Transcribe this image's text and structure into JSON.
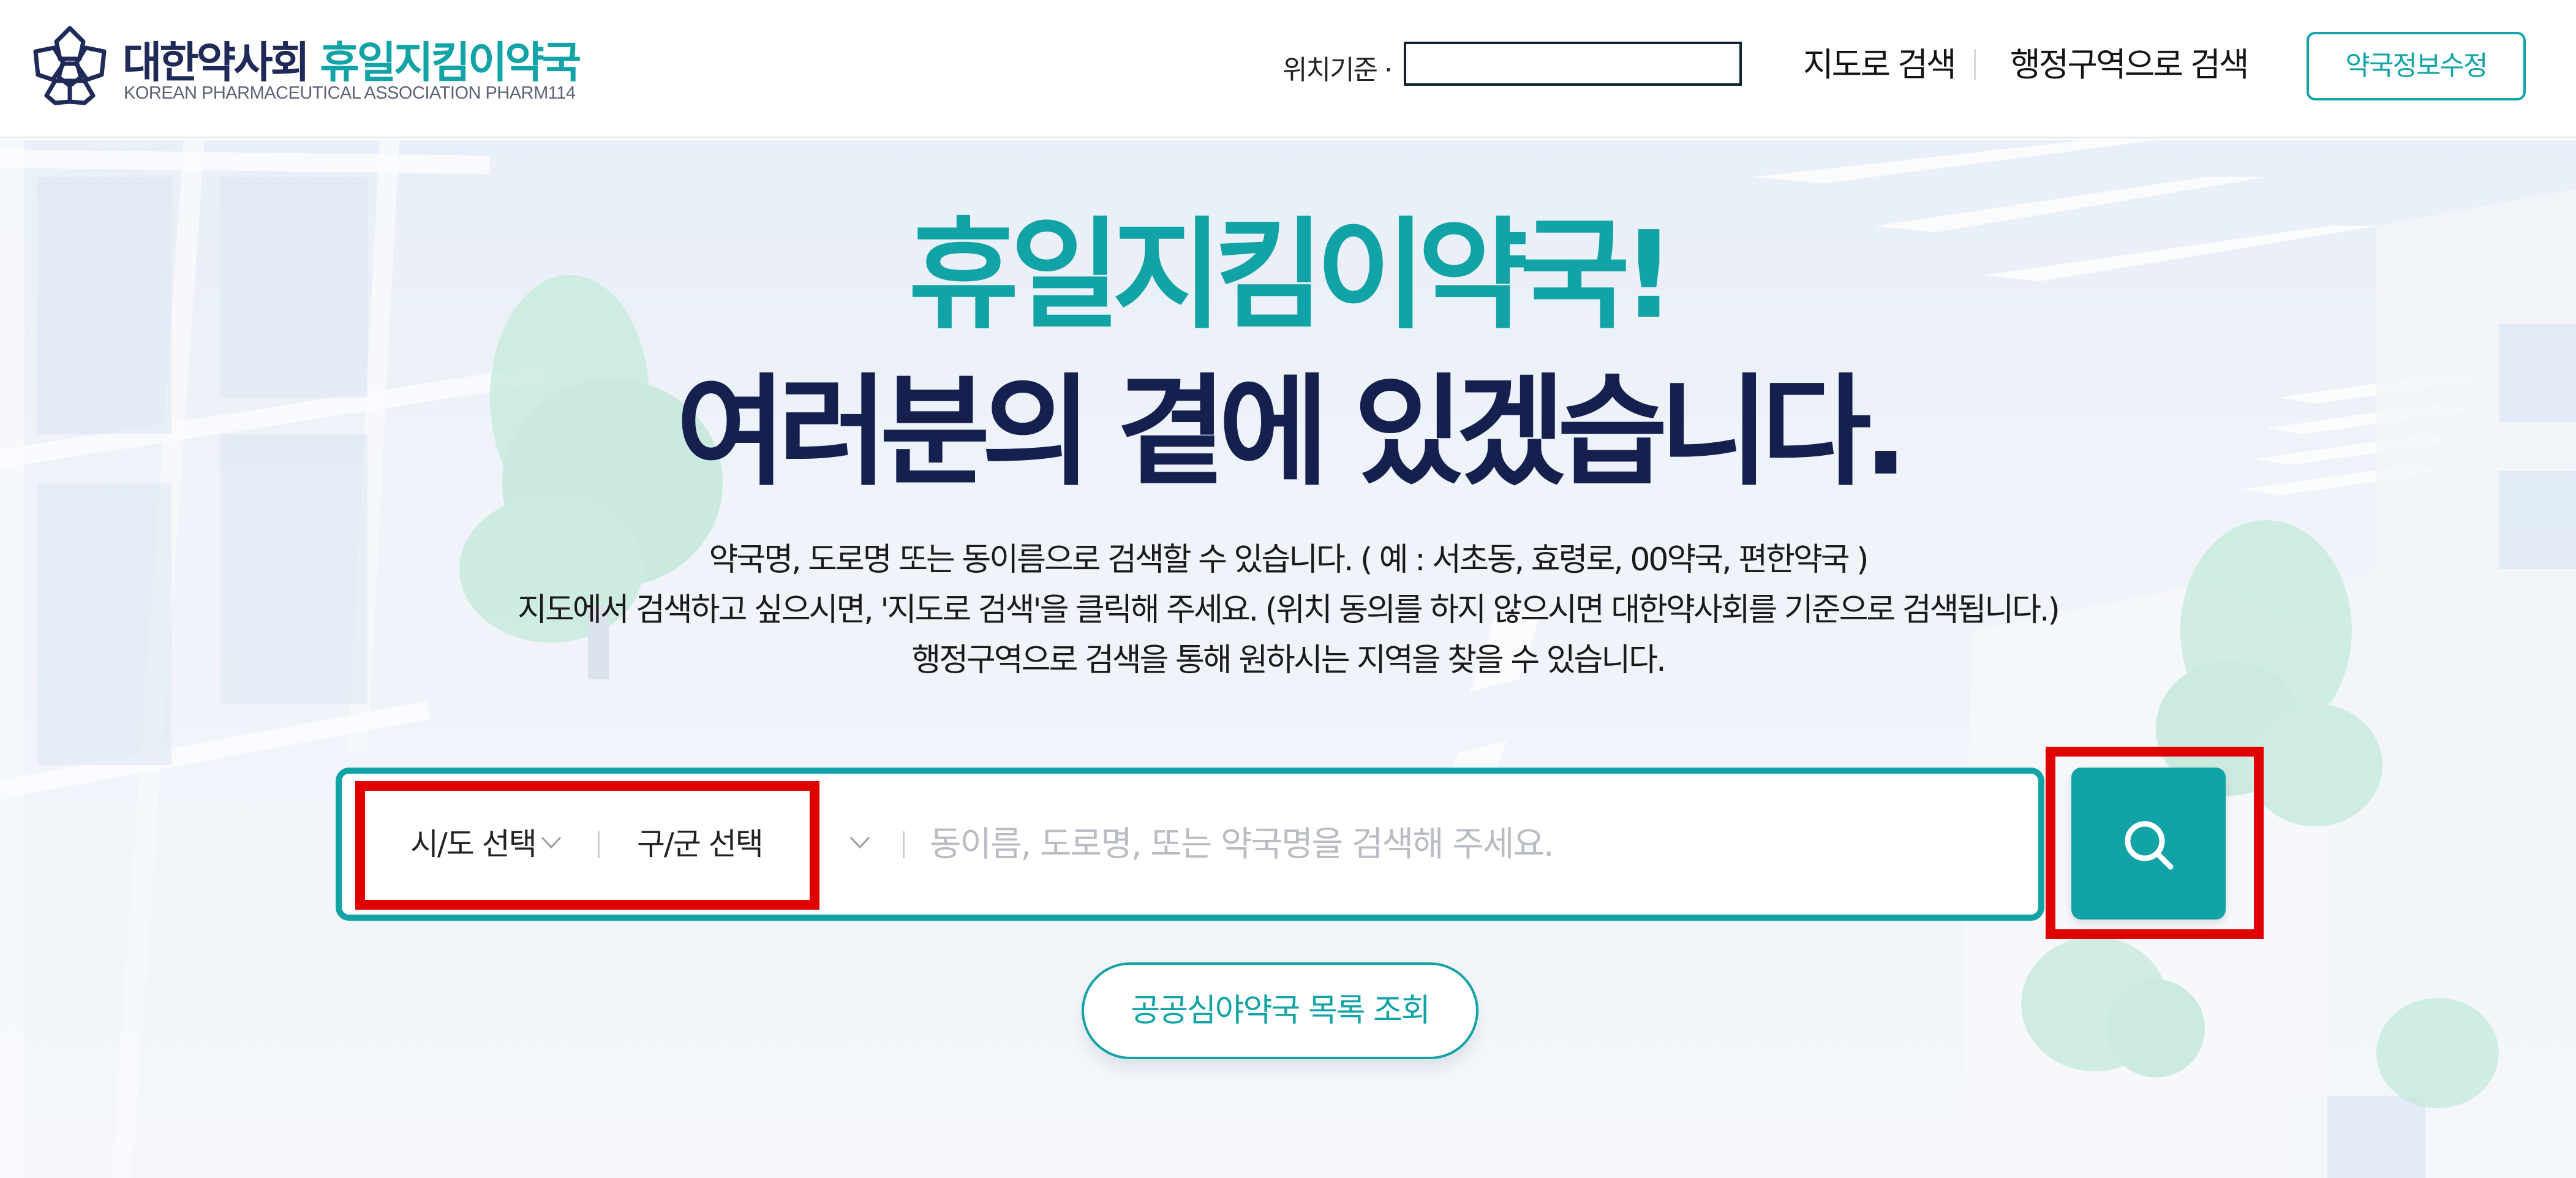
{
  "header": {
    "logo": {
      "title_dark": "대한약사회",
      "title_teal": "휴일지킴이약국",
      "subtitle": "KOREAN PHARMACEUTICAL ASSOCIATION PHARM114",
      "icon": "pharmacy-flower-logo-icon"
    },
    "location": {
      "label": "위치기준 ·",
      "value": ""
    },
    "nav": {
      "map_search": "지도로 검색",
      "region_search": "행정구역으로 검색"
    },
    "edit_button": "약국정보수정"
  },
  "hero": {
    "title_line1": "휴일지킴이약국!",
    "title_line2": "여러분의 곁에 있겠습니다.",
    "description": [
      "약국명, 도로명 또는 동이름으로 검색할 수 있습니다. ( 예 : 서초동, 효령로, 00약국, 편한약국 )",
      "지도에서 검색하고 싶으시면, '지도로 검색'을 클릭해 주세요. (위치 동의를 하지 않으시면 대한약사회를 기준으로 검색됩니다.)",
      "행정구역으로 검색을 통해 원하시는 지역을 찾을 수 있습니다."
    ]
  },
  "search": {
    "sido_select": "시/도 선택",
    "gugun_select": "구/군 선택",
    "input_value": "",
    "placeholder": "동이름, 도로명, 또는 약국명을 검색해 주세요.",
    "button_icon": "search-icon"
  },
  "public_night_button": "공공심야약국 목록 조회",
  "colors": {
    "teal": "#12a3a6",
    "navy": "#15204e",
    "highlight_red": "#e00000"
  }
}
